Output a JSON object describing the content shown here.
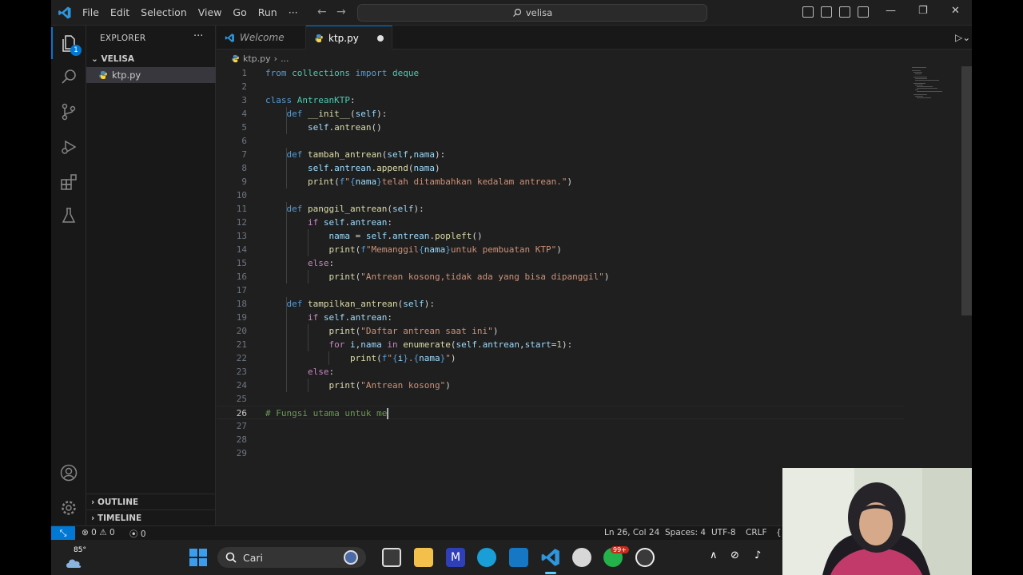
{
  "window": {
    "menu": [
      "File",
      "Edit",
      "Selection",
      "View",
      "Go",
      "Run",
      "···"
    ],
    "search": "velisa",
    "accent": "#0078d4"
  },
  "activity_bar": {
    "explorer_badge": "1",
    "icons": [
      "files-icon",
      "search-icon",
      "source-control-icon",
      "run-debug-icon",
      "extensions-icon",
      "testing-icon",
      "account-icon",
      "settings-icon"
    ]
  },
  "sidebar": {
    "title": "EXPLORER",
    "more": "···",
    "folder": "VELISA",
    "file": "ktp.py",
    "outline": "OUTLINE",
    "timeline": "TIMELINE"
  },
  "tabs": [
    {
      "label": "Welcome",
      "active": false
    },
    {
      "label": "ktp.py",
      "active": true,
      "dirty": true
    }
  ],
  "breadcrumb": {
    "file": "ktp.py",
    "rest": "..."
  },
  "code": [
    "from collections import deque",
    "",
    "class AntreanKTP:",
    "    def __init__(self):",
    "        self.antrean()",
    "",
    "    def tambah_antrean(self,nama):",
    "        self.antrean.append(nama)",
    "        print(f\"{nama}telah ditambahkan kedalam antrean.\")",
    "",
    "    def panggil_antrean(self):",
    "        if self.antrean:",
    "            nama = self.antrean.popleft()",
    "            print(f\"Memanggil{nama}untuk pembuatan KTP\")",
    "        else:",
    "            print(\"Antrean kosong,tidak ada yang bisa dipanggil\")",
    "",
    "    def tampilkan_antrean(self):",
    "        if self.antrean:",
    "            print(\"Daftar antrean saat ini\")",
    "            for i,nama in enumerate(self.antrean,start=1):",
    "                print(f\"{i}.{nama}\")",
    "        else:",
    "            print(\"Antrean kosong\")",
    "",
    "# Fungsi utama untuk me",
    "",
    "",
    ""
  ],
  "cursor_line": 26,
  "statusbar": {
    "errors": "0",
    "warnings": "0",
    "ports": "0",
    "position": "Ln 26, Col 24",
    "spaces": "Spaces: 4",
    "encoding": "UTF-8",
    "eol": "CRLF"
  },
  "taskbar": {
    "temperature": "85°",
    "search": "Cari",
    "badge": "99+"
  }
}
